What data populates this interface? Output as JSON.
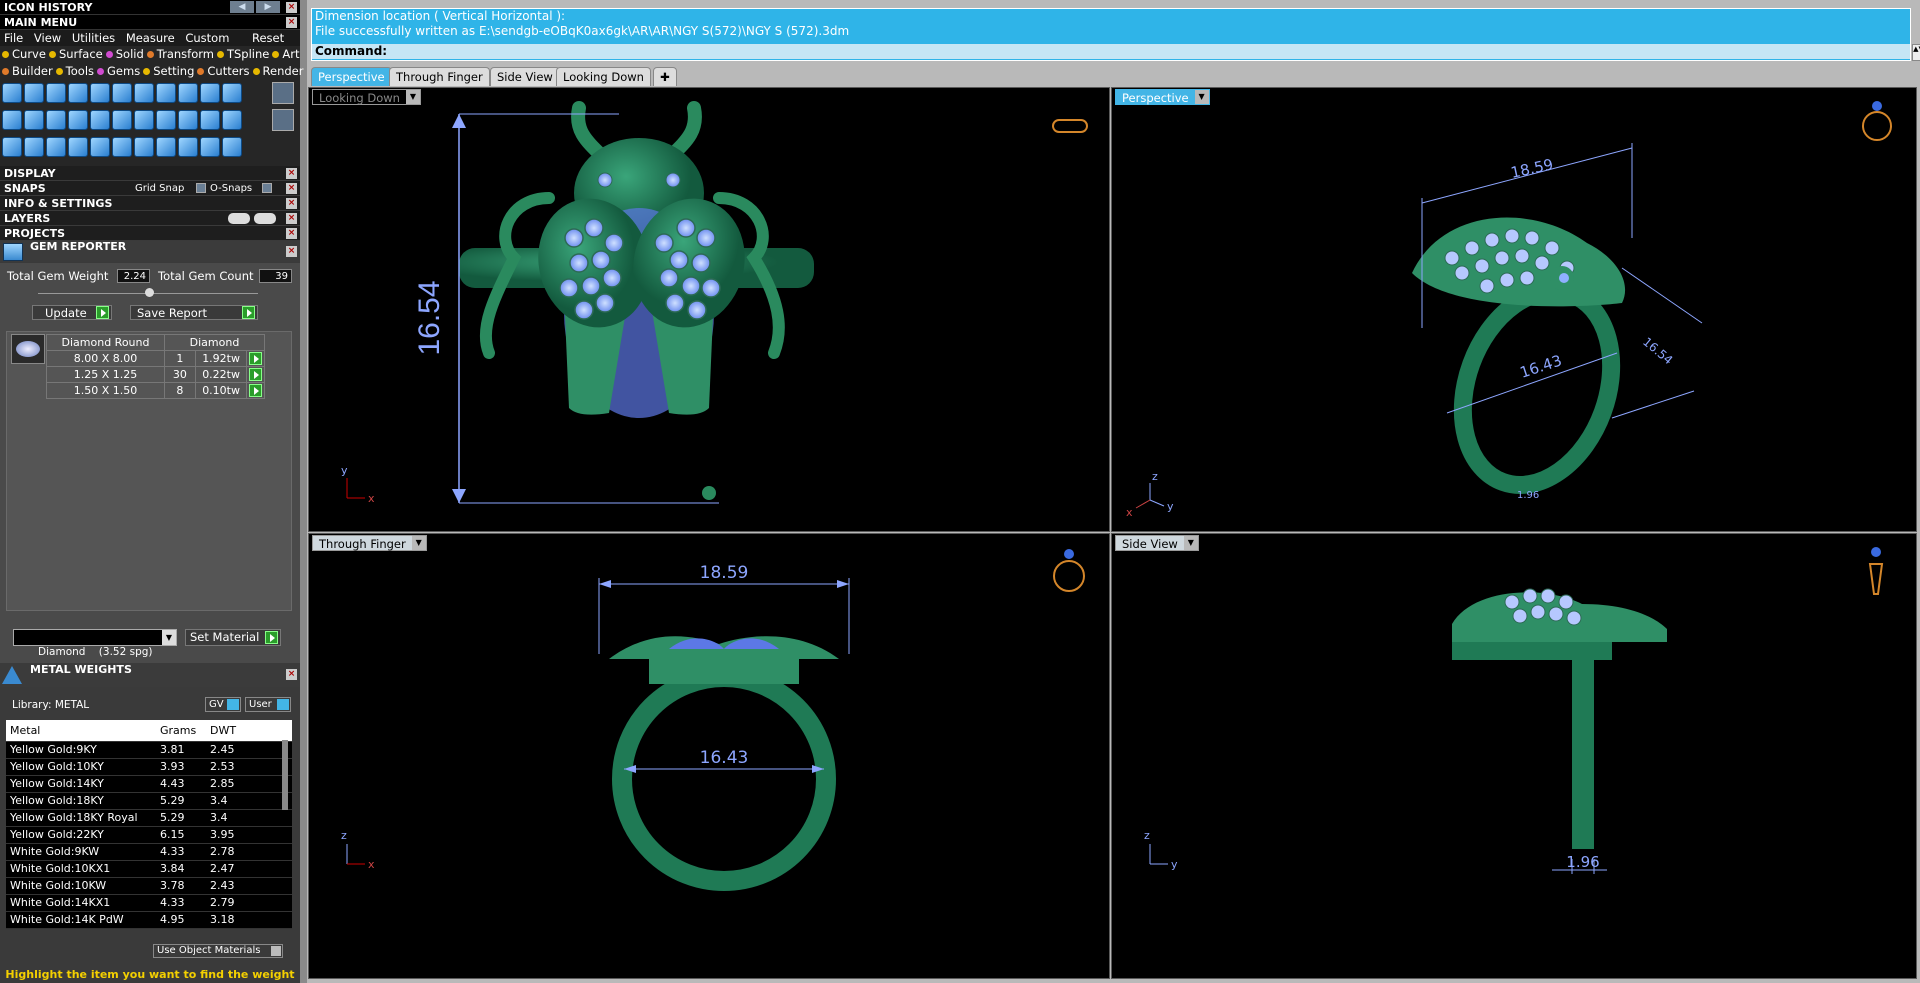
{
  "left": {
    "icon_history": "ICON HISTORY",
    "main_menu": "MAIN MENU",
    "menu": [
      "File",
      "View",
      "Utilities",
      "Measure",
      "Custom"
    ],
    "reset": "Reset",
    "tabs1": [
      {
        "label": "Curve",
        "color": "#e6b800"
      },
      {
        "label": "Surface",
        "color": "#e6b800"
      },
      {
        "label": "Solid",
        "color": "#d04bd0"
      },
      {
        "label": "Transform",
        "color": "#e07a2a"
      },
      {
        "label": "TSpline",
        "color": "#e6b800"
      },
      {
        "label": "Art",
        "color": "#e6b800"
      }
    ],
    "tabs2": [
      {
        "label": "Builder",
        "color": "#e07a2a"
      },
      {
        "label": "Tools",
        "color": "#e6b800"
      },
      {
        "label": "Gems",
        "color": "#d04bd0"
      },
      {
        "label": "Setting",
        "color": "#e6b800"
      },
      {
        "label": "Cutters",
        "color": "#e07a2a"
      },
      {
        "label": "Render",
        "color": "#e6b800"
      }
    ],
    "sections": {
      "display": "DISPLAY",
      "snaps": "SNAPS",
      "grid_snap": "Grid Snap",
      "osnaps": "O-Snaps",
      "info": "INFO & SETTINGS",
      "layers": "LAYERS",
      "projects": "PROJECTS"
    },
    "gem_reporter": {
      "title": "GEM REPORTER",
      "total_weight_label": "Total Gem Weight",
      "total_weight": "2.24",
      "total_count_label": "Total Gem Count",
      "total_count": "39",
      "update": "Update",
      "save_report": "Save Report",
      "headers": [
        "Diamond Round",
        "Diamond"
      ],
      "rows": [
        {
          "size": "8.00 X 8.00",
          "count": "1",
          "weight": "1.92tw"
        },
        {
          "size": "1.25 X 1.25",
          "count": "30",
          "weight": "0.22tw"
        },
        {
          "size": "1.50 X 1.50",
          "count": "8",
          "weight": "0.10tw"
        }
      ],
      "material": "Diamond    (3.52 spg)",
      "set_material": "Set Material"
    },
    "metal_weights": {
      "title": "METAL WEIGHTS",
      "library": "Library: METAL",
      "gv": "GV",
      "user": "User",
      "headers": [
        "Metal",
        "Grams",
        "DWT"
      ],
      "rows": [
        [
          "Yellow Gold:9KY",
          "3.81",
          "2.45"
        ],
        [
          "Yellow Gold:10KY",
          "3.93",
          "2.53"
        ],
        [
          "Yellow Gold:14KY",
          "4.43",
          "2.85"
        ],
        [
          "Yellow Gold:18KY",
          "5.29",
          "3.4"
        ],
        [
          "Yellow Gold:18KY Royal",
          "5.29",
          "3.4"
        ],
        [
          "Yellow Gold:22KY",
          "6.15",
          "3.95"
        ],
        [
          "White Gold:9KW",
          "4.33",
          "2.78"
        ],
        [
          "White Gold:10KX1",
          "3.84",
          "2.47"
        ],
        [
          "White Gold:10KW",
          "3.78",
          "2.43"
        ],
        [
          "White Gold:14KX1",
          "4.33",
          "2.79"
        ],
        [
          "White Gold:14K PdW",
          "4.95",
          "3.18"
        ]
      ],
      "use_object_materials": "Use Object Materials",
      "hint": "Highlight the item you want to find the weight"
    }
  },
  "command": {
    "line1": "Dimension location ( Vertical  Horizontal ):",
    "line2": "File successfully written as E:\\sendgb-eOBqK0ax6gk\\AR\\AR\\NGY S(572)\\NGY S (572).3dm",
    "line3": "Command:"
  },
  "view_tabs": [
    "Perspective",
    "Through Finger",
    "Side View",
    "Looking Down"
  ],
  "viewports": {
    "tl": {
      "label": "Looking Down",
      "dim": "16.54",
      "axis_y": "y",
      "axis_x": "x"
    },
    "tr": {
      "label": "Perspective",
      "dim_a": "18.59",
      "dim_b": "16.43",
      "dim_c": "16.54",
      "dim_d": "1.96",
      "axis_z": "z",
      "axis_x": "x",
      "axis_y": "y"
    },
    "bl": {
      "label": "Through Finger",
      "dim_a": "18.59",
      "dim_b": "16.43",
      "axis_z": "z",
      "axis_x": "x"
    },
    "br": {
      "label": "Side View",
      "dim": "1.96",
      "axis_z": "z",
      "axis_y": "y"
    }
  },
  "colors": {
    "accent": "#43b5e6",
    "metal": "#1f7a55",
    "gem": "#8fb0ff",
    "dim": "#8da6ff"
  }
}
